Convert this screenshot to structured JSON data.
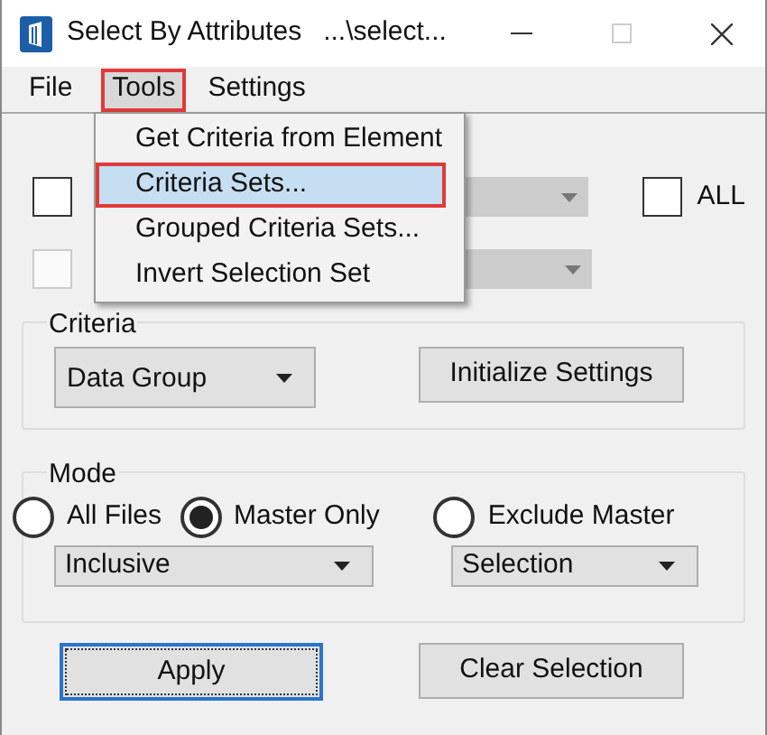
{
  "window": {
    "title": "Select By Attributes",
    "path": "...\\select..."
  },
  "menu_bar": [
    {
      "label": "File",
      "selected": false,
      "annotated": false
    },
    {
      "label": "Tools",
      "selected": true,
      "annotated": true
    },
    {
      "label": "Settings",
      "selected": false,
      "annotated": false
    }
  ],
  "tools_menu": [
    {
      "label": "Get Criteria from Element",
      "selected": false,
      "annotated": false
    },
    {
      "label": "Criteria Sets...",
      "selected": true,
      "annotated": true
    },
    {
      "label": "Grouped Criteria Sets...",
      "selected": false,
      "annotated": false
    },
    {
      "label": "Invert Selection Set",
      "selected": false
    }
  ],
  "rows": [
    {
      "checked": false,
      "disabled": false,
      "all_label": "ALL",
      "all_checked": false
    },
    {
      "checked": false,
      "disabled": true
    }
  ],
  "criteria": {
    "label": "Criteria",
    "dropdown": "Data Group",
    "button": "Initialize Settings"
  },
  "mode": {
    "label": "Mode",
    "radios": [
      {
        "label": "All Files",
        "selected": false
      },
      {
        "label": "Master Only",
        "selected": true
      },
      {
        "label": "Exclude Master",
        "selected": false
      }
    ],
    "dropdowns": [
      "Inclusive",
      "Selection"
    ]
  },
  "buttons": [
    {
      "label": "Apply",
      "focused": true
    },
    {
      "label": "Clear Selection",
      "focused": false
    }
  ]
}
